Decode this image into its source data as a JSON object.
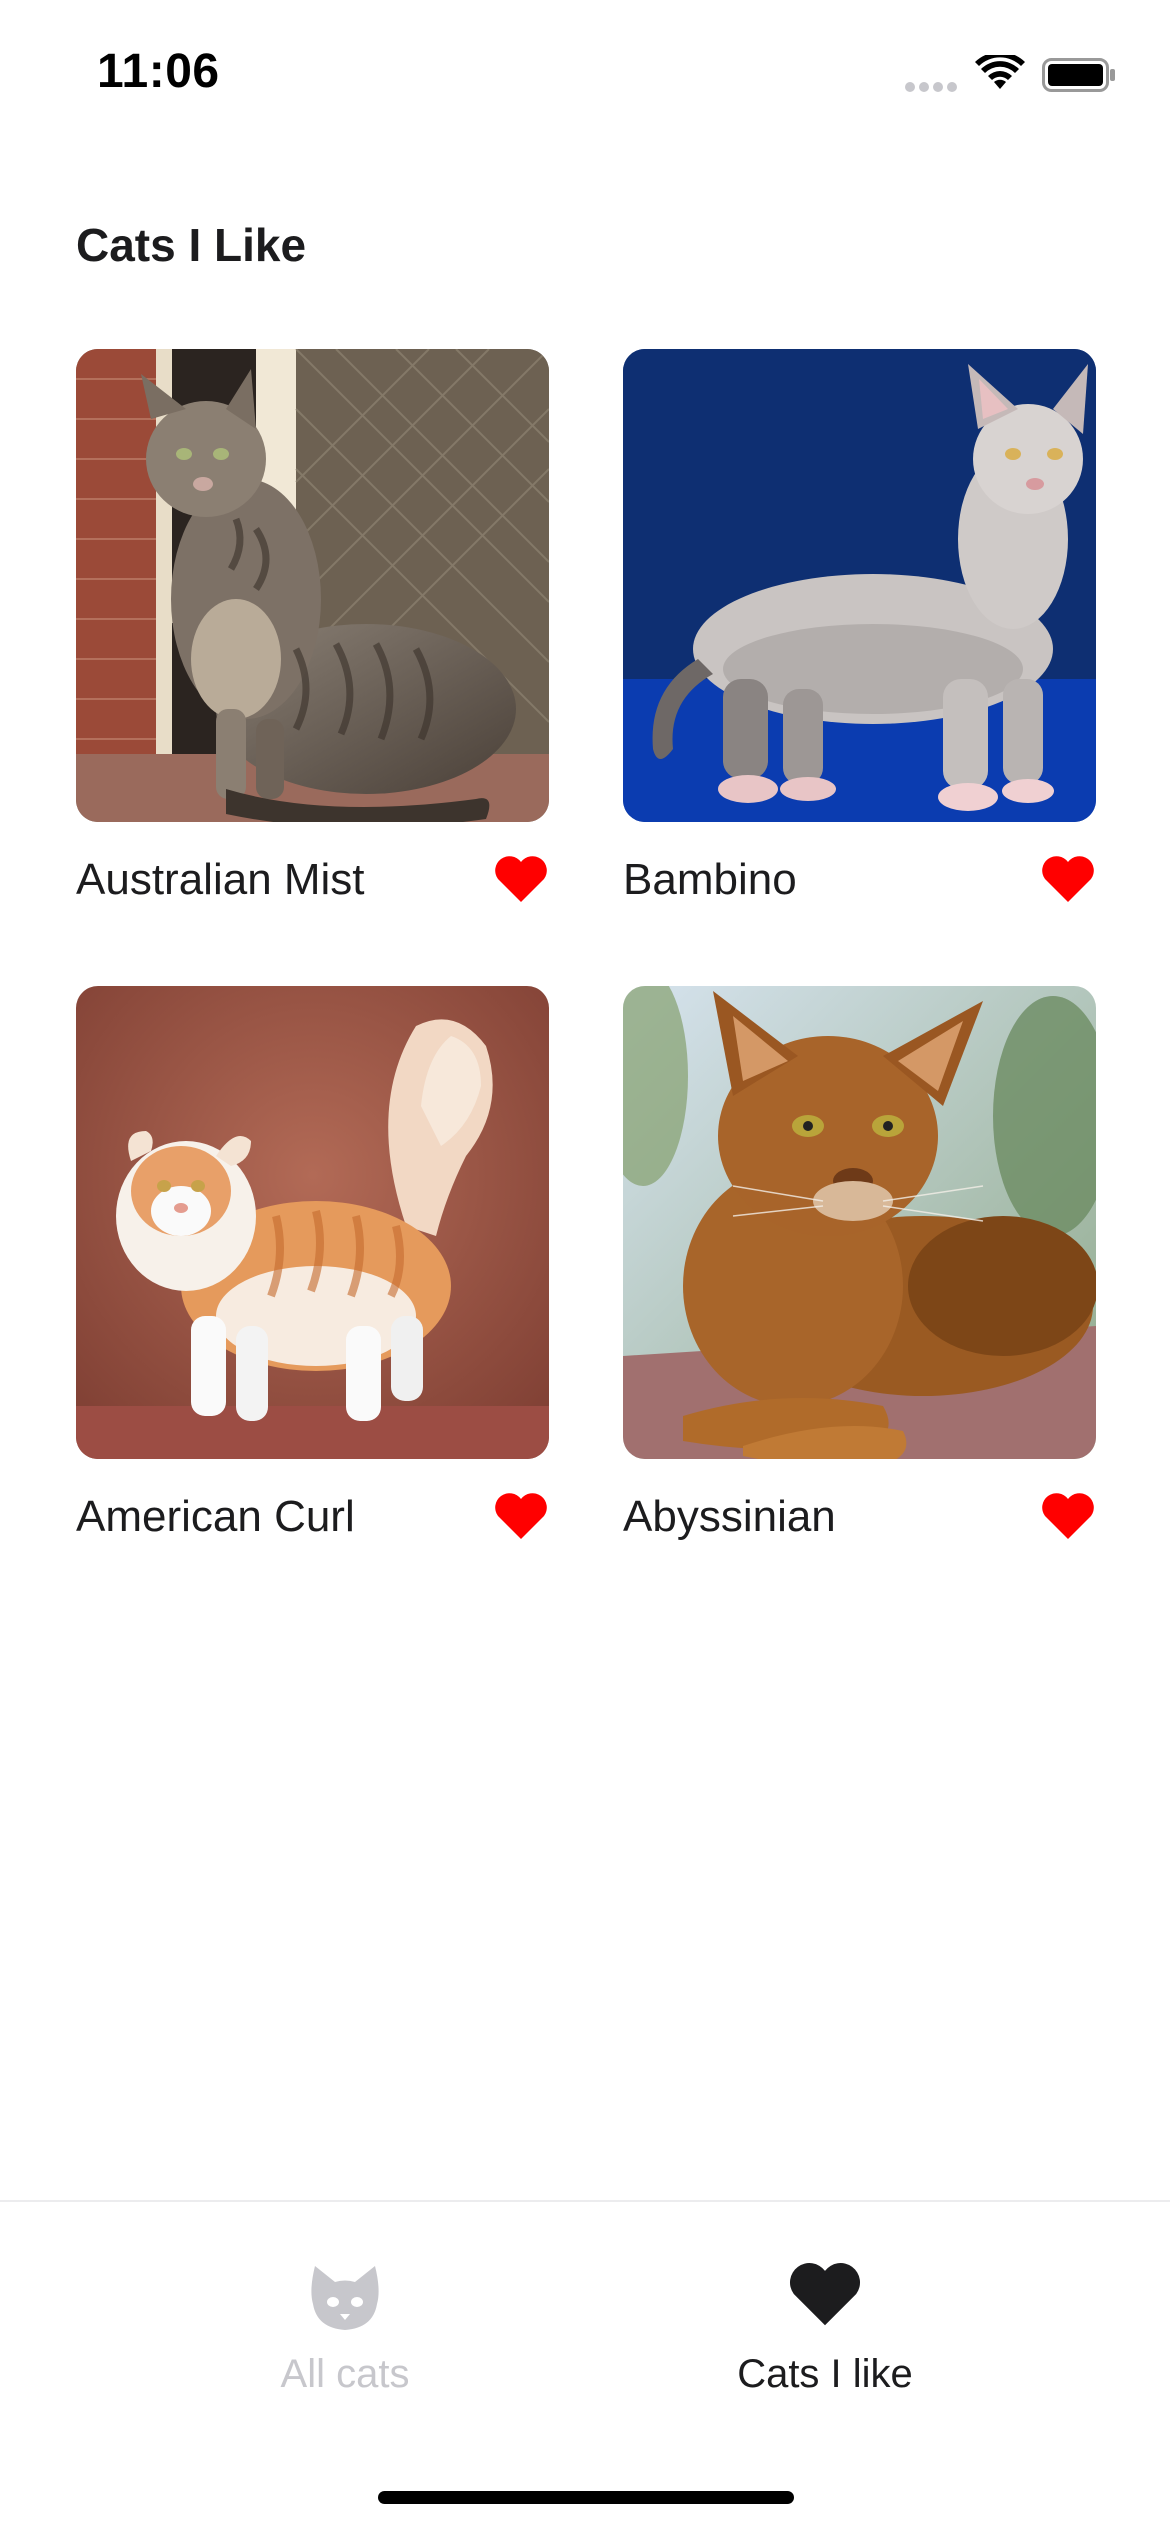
{
  "status_bar": {
    "time": "11:06"
  },
  "page": {
    "title": "Cats I Like"
  },
  "colors": {
    "heart": "#ff0000",
    "tab_active": "#1c1c1e",
    "tab_inactive": "#c7c7cc"
  },
  "cats": [
    {
      "name": "Australian Mist",
      "liked": true,
      "photo": "grey tabby cat sitting on a ledge"
    },
    {
      "name": "Bambino",
      "liked": true,
      "photo": "hairless cat standing on blue background"
    },
    {
      "name": "American Curl",
      "liked": true,
      "photo": "orange and white long-haired cat"
    },
    {
      "name": "Abyssinian",
      "liked": true,
      "photo": "ruddy cat lying down outdoors"
    }
  ],
  "tab_bar": {
    "tabs": [
      {
        "label": "All cats",
        "icon": "cat-face-icon",
        "active": false
      },
      {
        "label": "Cats I like",
        "icon": "heart-icon",
        "active": true
      }
    ]
  }
}
